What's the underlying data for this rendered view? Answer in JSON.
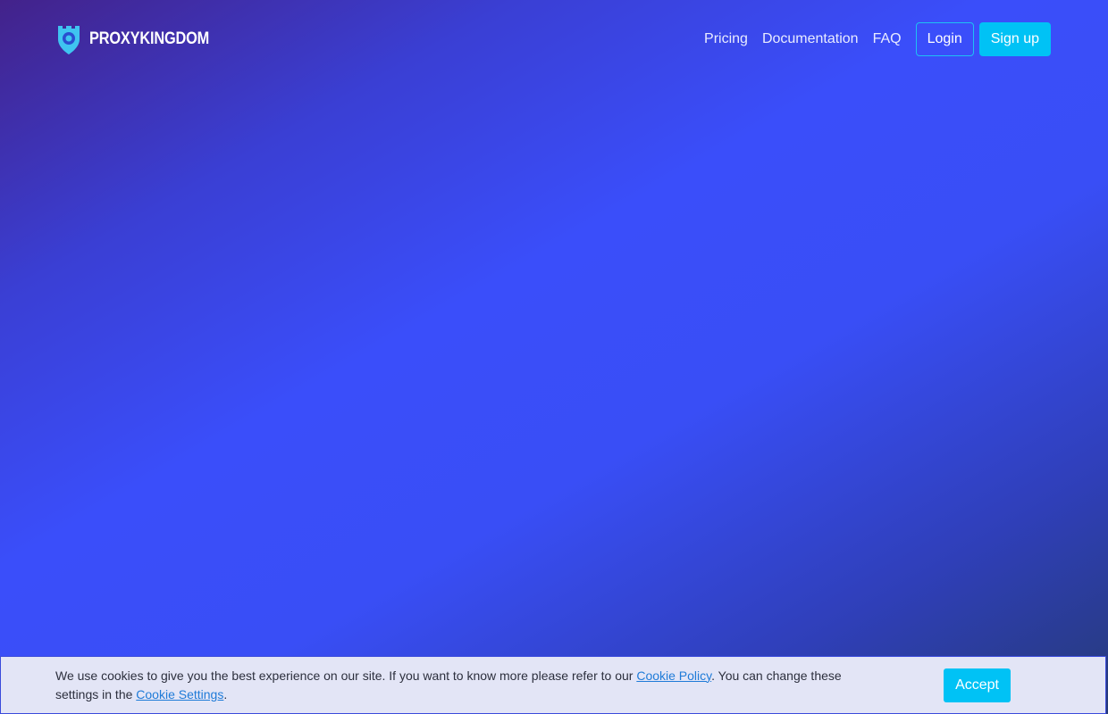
{
  "brand": {
    "name": "PROXYKINGDOM",
    "icon": "shield-pin-icon",
    "icon_color": "#3fc4f0"
  },
  "nav": {
    "links": [
      "Pricing",
      "Documentation",
      "FAQ"
    ],
    "login_label": "Login",
    "signup_label": "Sign up"
  },
  "cookie": {
    "text_before_policy": "We use cookies to give you the best experience on our site. If you want to know more please refer to our ",
    "policy_link": "Cookie Policy",
    "text_middle": ". You can change these settings in the ",
    "settings_link": "Cookie Settings",
    "text_after": ".",
    "accept_label": "Accept"
  },
  "colors": {
    "accent": "#00c2f5",
    "background_start": "#43228a",
    "background_mid": "#394ef6",
    "background_end": "#263a78",
    "link": "#1f7bd8"
  }
}
